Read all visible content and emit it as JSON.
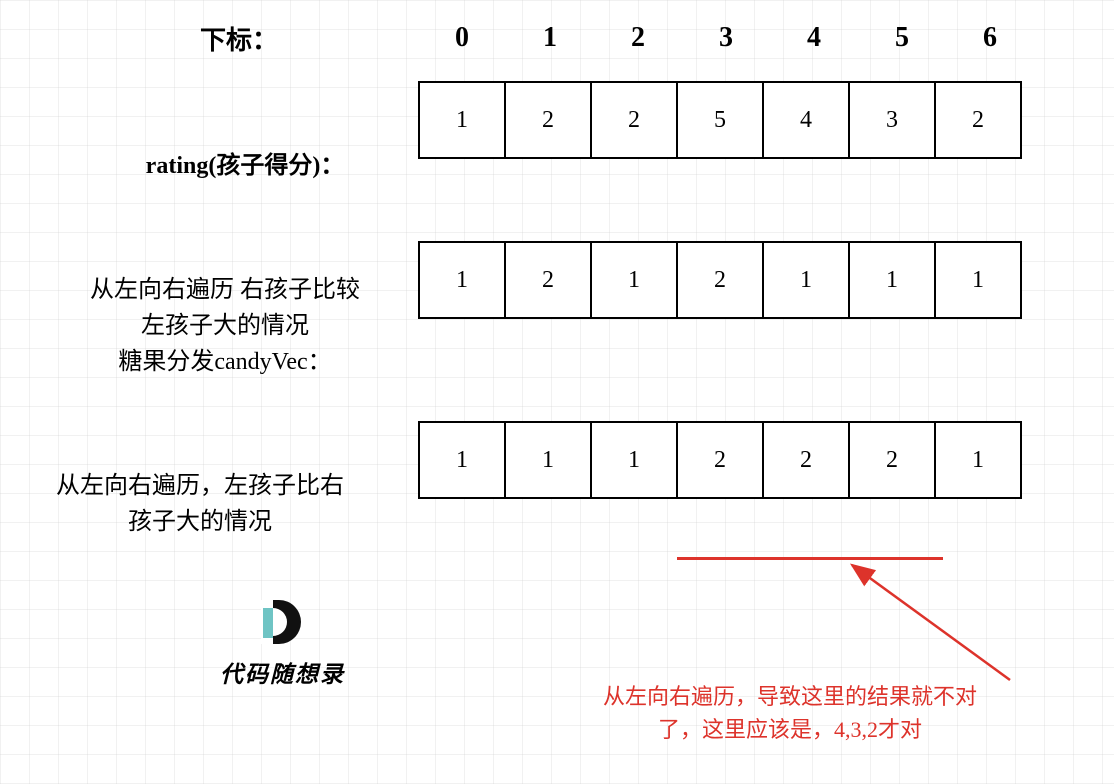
{
  "index_label": "下标：",
  "indices": [
    "0",
    "1",
    "2",
    "3",
    "4",
    "5",
    "6"
  ],
  "rows": {
    "rating": {
      "label": "rating(孩子得分)：",
      "values": [
        "1",
        "2",
        "2",
        "5",
        "4",
        "3",
        "2"
      ]
    },
    "pass1": {
      "label": "从左向右遍历 右孩子比较\n左孩子大的情况\n糖果分发candyVec：",
      "values": [
        "1",
        "2",
        "1",
        "2",
        "1",
        "1",
        "1"
      ]
    },
    "pass2": {
      "label": "从左向右遍历，左孩子比右\n孩子大的情况",
      "values": [
        "1",
        "1",
        "1",
        "2",
        "2",
        "2",
        "1"
      ]
    }
  },
  "annotation": "从左向右遍历，导致这里的结果就不对\n了，这里应该是，4,3,2才对",
  "brand": "代码随想录",
  "chart_data": {
    "type": "table",
    "title": "candy distribution traversal diagram",
    "index": [
      0,
      1,
      2,
      3,
      4,
      5,
      6
    ],
    "rating": [
      1,
      2,
      2,
      5,
      4,
      3,
      2
    ],
    "left_to_right_candy": [
      1,
      2,
      1,
      2,
      1,
      1,
      1
    ],
    "left_to_right_reverse_case": [
      1,
      1,
      1,
      2,
      2,
      2,
      1
    ],
    "highlight_range_indices": [
      3,
      4,
      5
    ],
    "expected_highlight_values": [
      4,
      3,
      2
    ]
  }
}
